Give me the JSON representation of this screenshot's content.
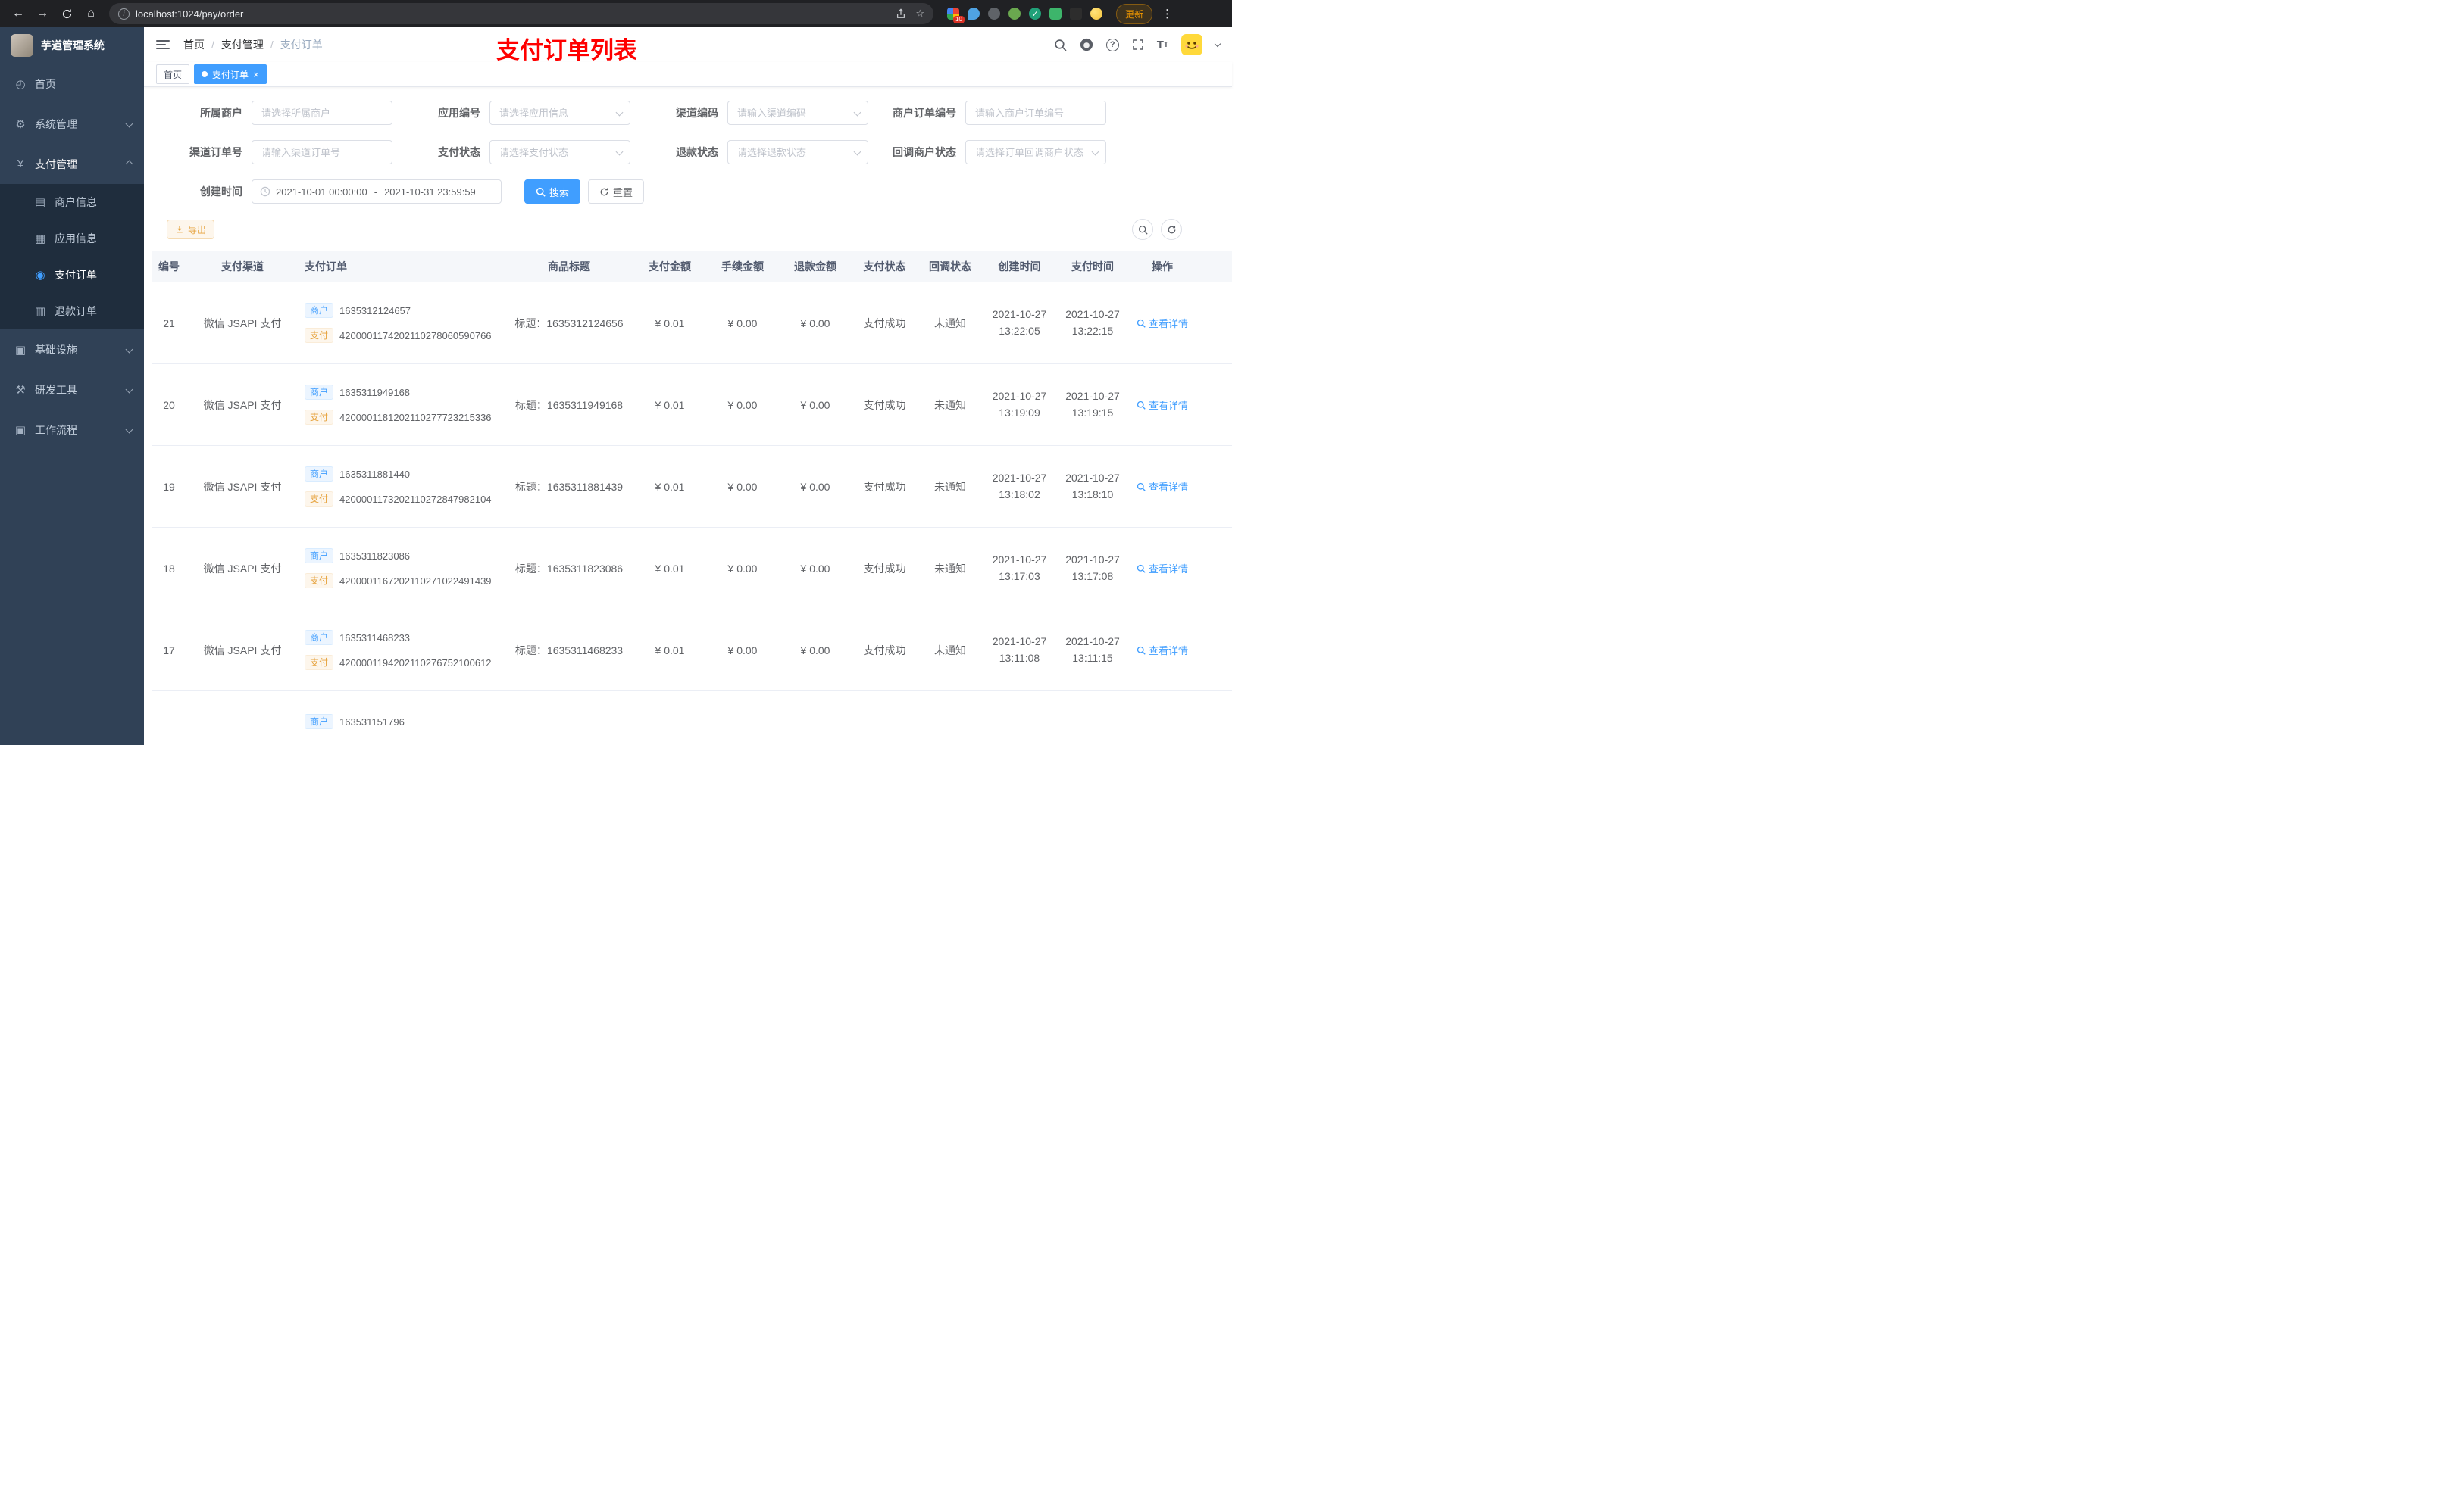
{
  "browser": {
    "url": "localhost:1024/pay/order",
    "update_label": "更新",
    "extension_badge": "10"
  },
  "sidebar": {
    "title": "芋道管理系统",
    "items": [
      {
        "label": "首页"
      },
      {
        "label": "系统管理"
      },
      {
        "label": "支付管理"
      },
      {
        "label": "商户信息"
      },
      {
        "label": "应用信息"
      },
      {
        "label": "支付订单"
      },
      {
        "label": "退款订单"
      },
      {
        "label": "基础设施"
      },
      {
        "label": "研发工具"
      },
      {
        "label": "工作流程"
      }
    ]
  },
  "header": {
    "breadcrumb": [
      "首页",
      "支付管理",
      "支付订单"
    ],
    "separator": "/",
    "annotation": "支付订单列表"
  },
  "tabs": [
    {
      "label": "首页"
    },
    {
      "label": "支付订单"
    }
  ],
  "filters": {
    "fields": [
      {
        "label": "所属商户",
        "placeholder": "请选择所属商户"
      },
      {
        "label": "应用编号",
        "placeholder": "请选择应用信息"
      },
      {
        "label": "渠道编码",
        "placeholder": "请输入渠道编码"
      },
      {
        "label": "商户订单编号",
        "placeholder": "请输入商户订单编号"
      },
      {
        "label": "渠道订单号",
        "placeholder": "请输入渠道订单号"
      },
      {
        "label": "支付状态",
        "placeholder": "请选择支付状态"
      },
      {
        "label": "退款状态",
        "placeholder": "请选择退款状态"
      },
      {
        "label": "回调商户状态",
        "placeholder": "请选择订单回调商户状态"
      }
    ],
    "date_label": "创建时间",
    "date_start": "2021-10-01 00:00:00",
    "date_sep": "-",
    "date_end": "2021-10-31 23:59:59",
    "search_label": "搜索",
    "reset_label": "重置"
  },
  "toolbar": {
    "export_label": "导出"
  },
  "table": {
    "columns": [
      "编号",
      "支付渠道",
      "支付订单",
      "商品标题",
      "支付金额",
      "手续金额",
      "退款金额",
      "支付状态",
      "回调状态",
      "创建时间",
      "支付时间",
      "操作"
    ],
    "merchant_tag_label": "商户",
    "pay_tag_label": "支付",
    "action_label": "查看详情",
    "rows": [
      {
        "id": "21",
        "channel": "微信 JSAPI 支付",
        "merchant_no": "1635312124657",
        "pay_no": "4200001174202110278060590766",
        "title": "标题：1635312124656",
        "pay_amount": "¥ 0.01",
        "fee_amount": "¥ 0.00",
        "refund_amount": "¥ 0.00",
        "pay_status": "支付成功",
        "notify_status": "未通知",
        "create_date": "2021-10-27",
        "create_clock": "13:22:05",
        "pay_date": "2021-10-27",
        "pay_clock": "13:22:15"
      },
      {
        "id": "20",
        "channel": "微信 JSAPI 支付",
        "merchant_no": "1635311949168",
        "pay_no": "4200001181202110277723215336",
        "title": "标题：1635311949168",
        "pay_amount": "¥ 0.01",
        "fee_amount": "¥ 0.00",
        "refund_amount": "¥ 0.00",
        "pay_status": "支付成功",
        "notify_status": "未通知",
        "create_date": "2021-10-27",
        "create_clock": "13:19:09",
        "pay_date": "2021-10-27",
        "pay_clock": "13:19:15"
      },
      {
        "id": "19",
        "channel": "微信 JSAPI 支付",
        "merchant_no": "1635311881440",
        "pay_no": "4200001173202110272847982104",
        "title": "标题：1635311881439",
        "pay_amount": "¥ 0.01",
        "fee_amount": "¥ 0.00",
        "refund_amount": "¥ 0.00",
        "pay_status": "支付成功",
        "notify_status": "未通知",
        "create_date": "2021-10-27",
        "create_clock": "13:18:02",
        "pay_date": "2021-10-27",
        "pay_clock": "13:18:10"
      },
      {
        "id": "18",
        "channel": "微信 JSAPI 支付",
        "merchant_no": "1635311823086",
        "pay_no": "4200001167202110271022491439",
        "title": "标题：1635311823086",
        "pay_amount": "¥ 0.01",
        "fee_amount": "¥ 0.00",
        "refund_amount": "¥ 0.00",
        "pay_status": "支付成功",
        "notify_status": "未通知",
        "create_date": "2021-10-27",
        "create_clock": "13:17:03",
        "pay_date": "2021-10-27",
        "pay_clock": "13:17:08"
      },
      {
        "id": "17",
        "channel": "微信 JSAPI 支付",
        "merchant_no": "1635311468233",
        "pay_no": "4200001194202110276752100612",
        "title": "标题：1635311468233",
        "pay_amount": "¥ 0.01",
        "fee_amount": "¥ 0.00",
        "refund_amount": "¥ 0.00",
        "pay_status": "支付成功",
        "notify_status": "未通知",
        "create_date": "2021-10-27",
        "create_clock": "13:11:08",
        "pay_date": "2021-10-27",
        "pay_clock": "13:11:15"
      }
    ],
    "partial_row": {
      "merchant_no": "163531151796"
    }
  }
}
